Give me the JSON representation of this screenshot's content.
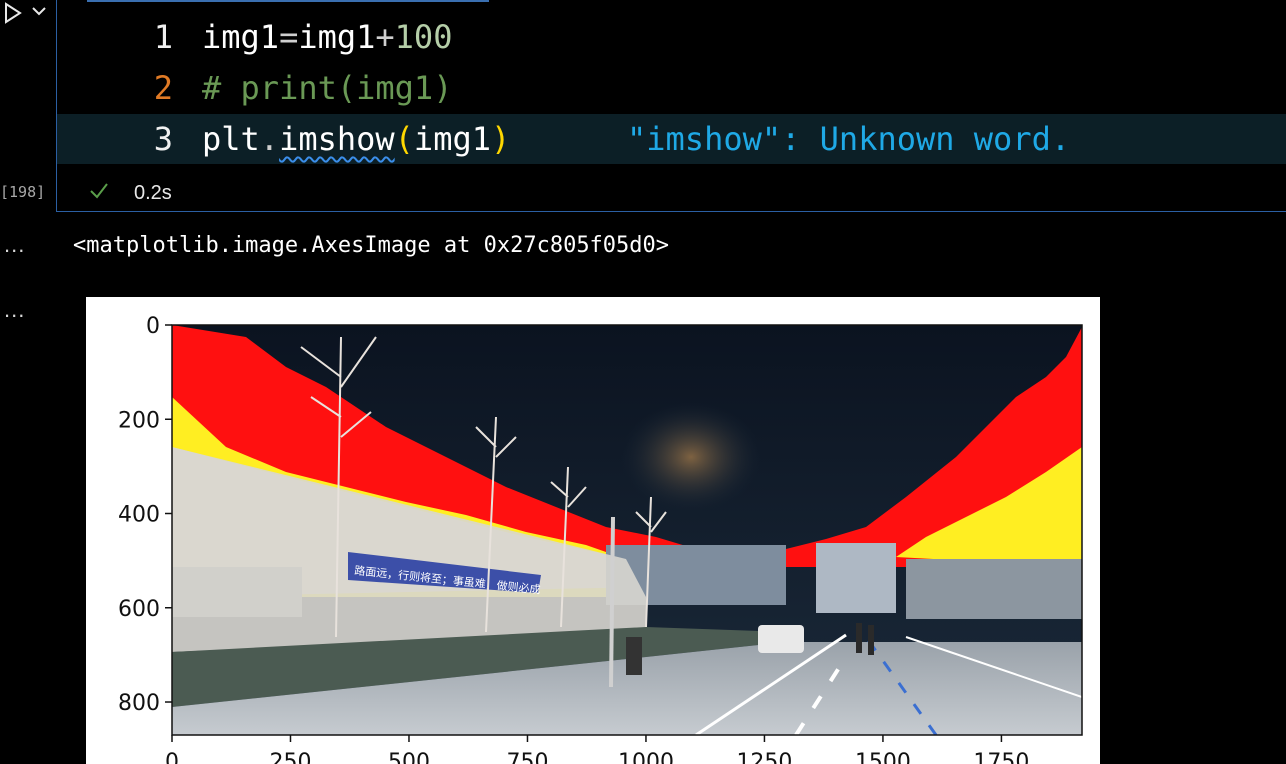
{
  "cell": {
    "execution_count": "[198]",
    "status_time": "0.2s",
    "lines": [
      {
        "number": "1"
      },
      {
        "number": "2"
      },
      {
        "number": "3"
      }
    ],
    "code": {
      "l1_a": "img1",
      "l1_eq": "=",
      "l1_b": "img1",
      "l1_plus": "+",
      "l1_num": "100",
      "l2_comment": "# print(img1)",
      "l3_plt": "plt",
      "l3_dot": ".",
      "l3_fn": "imshow",
      "l3_open": "(",
      "l3_arg": "img1",
      "l3_close": ")"
    },
    "diagnostic": "\"imshow\": Unknown word."
  },
  "outputs": {
    "ellipsis_1": "...",
    "repr_text": "<matplotlib.image.AxesImage at 0x27c805f05d0>",
    "ellipsis_2": "..."
  },
  "plot": {
    "y_ticks": [
      "0",
      "200",
      "400",
      "600",
      "800"
    ],
    "x_ticks": [
      "0",
      "250",
      "500",
      "750",
      "1000",
      "1250",
      "1500",
      "1750"
    ],
    "banner_text": "路面远，行则将至；事虽难，做则必成"
  },
  "colors": {
    "accent_border": "#2b5fa3",
    "current_line_number": "#e07a25",
    "diagnostic": "#1fa9e6",
    "check": "#5a9e4a"
  }
}
